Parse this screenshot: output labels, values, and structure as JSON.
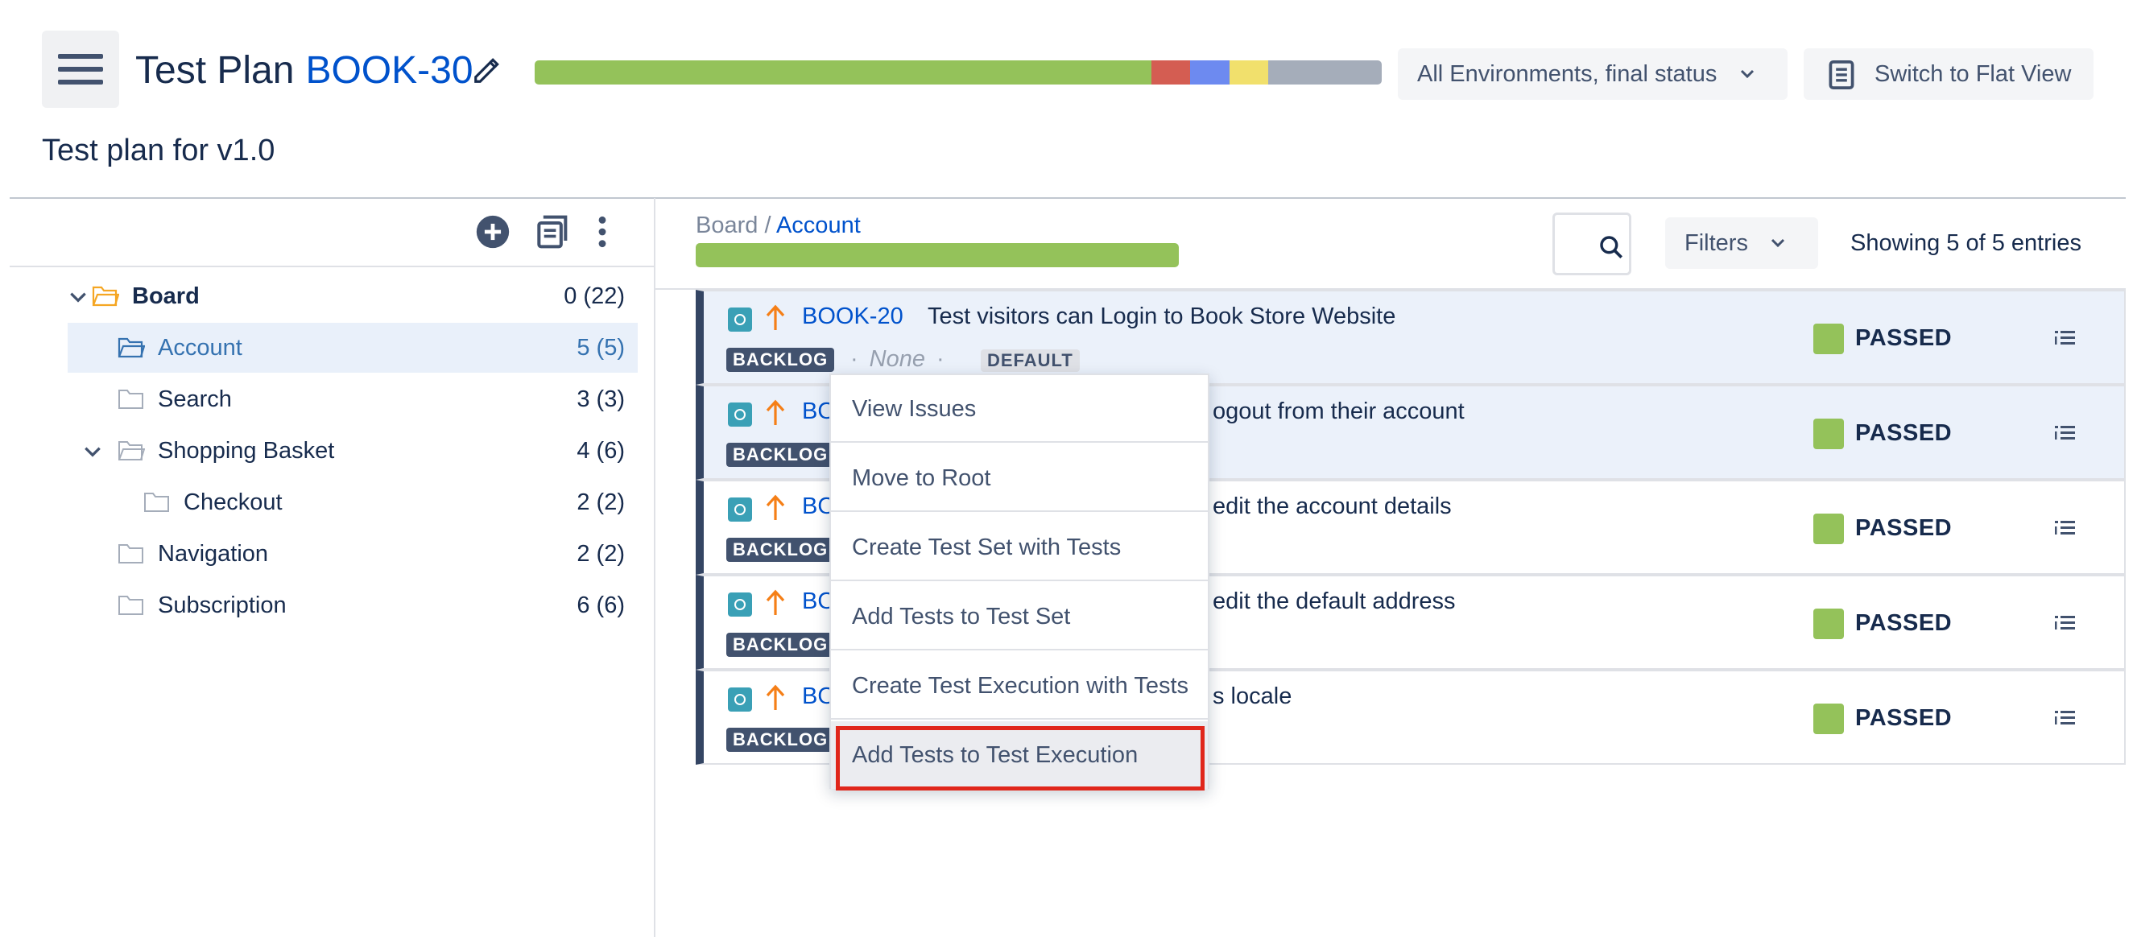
{
  "header": {
    "title_prefix": "Test Plan",
    "issue_key": "BOOK-30",
    "subtitle": "Test plan for v1.0",
    "progress_segments": [
      {
        "status": "passed",
        "fraction": 0.728,
        "color": "#94c25a"
      },
      {
        "status": "failed",
        "fraction": 0.046,
        "color": "#d45d52"
      },
      {
        "status": "executing",
        "fraction": 0.046,
        "color": "#6d8af0"
      },
      {
        "status": "todo",
        "fraction": 0.046,
        "color": "#f1e06c"
      },
      {
        "status": "not run",
        "fraction": 0.134,
        "color": "#a5adba"
      }
    ],
    "environment_select": "All Environments, final status",
    "switch_view_label": "Switch to Flat View"
  },
  "tree": {
    "items": [
      {
        "label": "Board",
        "count": "0 (22)",
        "expanded": true,
        "level": 0
      },
      {
        "label": "Account",
        "count": "5 (5)",
        "selected": true,
        "level": 1
      },
      {
        "label": "Search",
        "count": "3 (3)",
        "level": 1
      },
      {
        "label": "Shopping Basket",
        "count": "4 (6)",
        "expanded": true,
        "level": 1
      },
      {
        "label": "Checkout",
        "count": "2 (2)",
        "level": 2
      },
      {
        "label": "Navigation",
        "count": "2 (2)",
        "level": 1
      },
      {
        "label": "Subscription",
        "count": "6 (6)",
        "level": 1
      }
    ]
  },
  "breadcrumb": {
    "root": "Board",
    "separator": " / ",
    "current": "Account"
  },
  "toolbar": {
    "filters_label": "Filters",
    "showing": "Showing 5 of 5 entries"
  },
  "tests": [
    {
      "key": "BOOK-20",
      "summary": "Test visitors can Login to Book Store Website",
      "status_label": "BACKLOG",
      "meta": "None",
      "tag": "DEFAULT",
      "result": "PASSED"
    },
    {
      "key": "BO",
      "summary": "ogout from their account",
      "status_label": "BACKLOG",
      "result": "PASSED"
    },
    {
      "key": "BO",
      "summary": "edit the account details",
      "status_label": "BACKLOG",
      "result": "PASSED"
    },
    {
      "key": "BO",
      "summary": "edit the default address",
      "status_label": "BACKLOG",
      "result": "PASSED"
    },
    {
      "key": "BO",
      "summary": "s locale",
      "status_label": "BACKLOG",
      "result": "PASSED"
    }
  ],
  "context_menu": {
    "items": [
      "View Issues",
      "Move to Root",
      "Create Test Set with Tests",
      "Add Tests to Test Set",
      "Create Test Execution with Tests",
      "Add Tests to Test Execution"
    ]
  },
  "colors": {
    "accent": "#0052cc",
    "passed": "#94c25a",
    "highlight_border": "#e0261b"
  }
}
